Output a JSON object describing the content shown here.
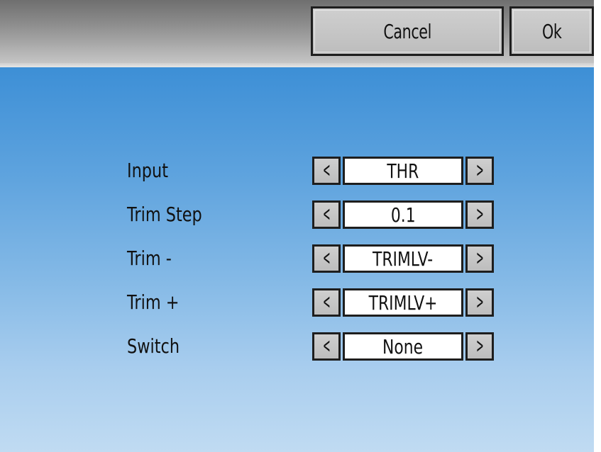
{
  "toolbar": {
    "cancel_label": "Cancel",
    "ok_label": "Ok"
  },
  "form": {
    "rows": [
      {
        "label": "Input",
        "value": "THR",
        "prev": "<",
        "next": ">"
      },
      {
        "label": "Trim Step",
        "value": "0.1",
        "prev": "<",
        "next": ">"
      },
      {
        "label": "Trim -",
        "value": "TRIMLV-",
        "prev": "<",
        "next": ">"
      },
      {
        "label": "Trim +",
        "value": "TRIMLV+",
        "prev": "<",
        "next": ">"
      },
      {
        "label": "Switch",
        "value": "None",
        "prev": "<",
        "next": ">"
      }
    ]
  },
  "icons": {
    "prev": "chevron-left-icon",
    "next": "chevron-right-icon"
  },
  "colors": {
    "toolbar_top": "#6f6f6f",
    "toolbar_bottom": "#c5c5c5",
    "background_top": "#3d8fd6",
    "background_bottom": "#c0dbf2",
    "button_face": "#c6c6c6",
    "border": "#1e1e1e"
  }
}
